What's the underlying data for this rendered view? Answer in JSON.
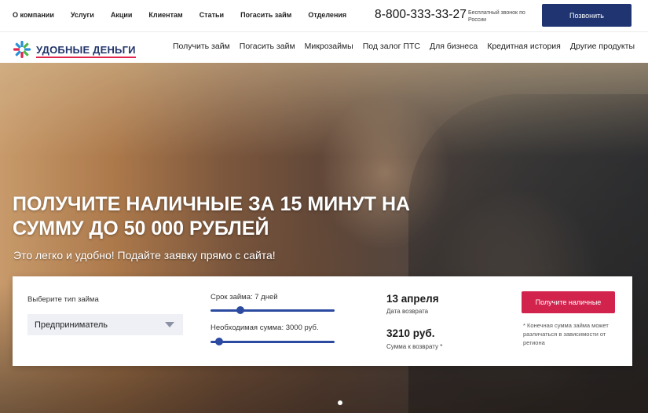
{
  "topnav": [
    "О компании",
    "Услуги",
    "Акции",
    "Клиентам",
    "Статьи",
    "Погасить займ",
    "Отделения"
  ],
  "phone": "8-800-333-33-27",
  "phone_note": "Бесплатный звонок по России",
  "call_button": "Позвонить",
  "logo": {
    "text": "УДОБНЫЕ ДЕНЬГИ",
    "accent": "#e0244c",
    "brand": "#22356c"
  },
  "mainnav": [
    "Получить займ",
    "Погасить займ",
    "Микрозаймы",
    "Под залог ПТС",
    "Для бизнеса",
    "Кредитная история",
    "Другие продукты"
  ],
  "hero": {
    "title": "ПОЛУЧИТЕ НАЛИЧНЫЕ ЗА 15 МИНУТ НА СУММУ ДО 50 000 РУБЛЕЙ",
    "subtitle": "Это легко и удобно! Подайте заявку прямо с сайта!"
  },
  "form": {
    "type_label": "Выберите тип займа",
    "type_value": "Предприниматель",
    "term_label": "Срок займа: 7 дней",
    "term_level": 0.22,
    "amount_label": "Необходимая сумма: 3000 руб.",
    "amount_level": 0.04,
    "return_date": "13 апреля",
    "return_date_label": "Дата возврата",
    "return_sum": "3210 руб.",
    "return_sum_label": "Сумма к возврату *",
    "cta": "Получите наличные",
    "note": "* Конечная сумма займа может различаться в зависимости от региона"
  },
  "colors": {
    "primary": "#1f3470",
    "cta": "#d2234d",
    "slider": "#2b4aa0"
  }
}
